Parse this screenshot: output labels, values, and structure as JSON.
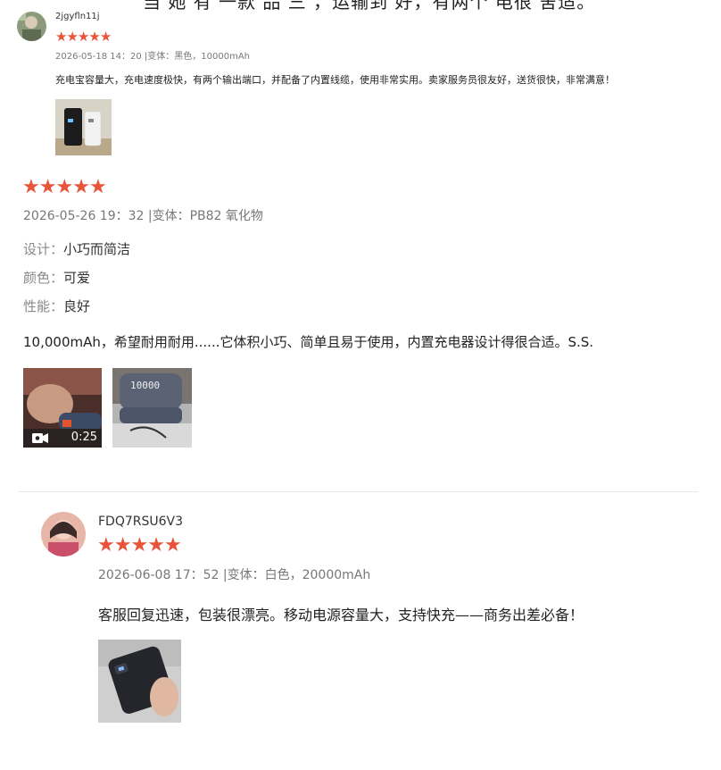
{
  "cutoff_text": "当 她 有  一款  品 三 ，运输到 好，有两个 电很 舍适。",
  "colors": {
    "star": "#e8543a",
    "text": "#222222",
    "meta": "#777777",
    "divider": "#e9e9e9"
  },
  "reviews": [
    {
      "username": "2jgyfln11j",
      "rating": 5,
      "meta": "2026-05-18 14：20 |变体：黑色，10000mAh",
      "body": "充电宝容量大，充电速度极快，有两个输出端口，并配备了内置线缆，使用非常实用。卖家服务员很友好，送货很快，非常满意！",
      "images": [
        {
          "kind": "photo",
          "icon": "powerbank-photo"
        }
      ]
    },
    {
      "username": "",
      "rating": 5,
      "meta": "2026-05-26 19：32 |变体：PB82 氧化物",
      "attributes": [
        {
          "key": "设计：",
          "value": "小巧而简洁"
        },
        {
          "key": "颜色：",
          "value": "可爱"
        },
        {
          "key": "性能：",
          "value": "良好"
        }
      ],
      "body": "10,000mAh，希望耐用耐用......它体积小巧、简单且易于使用，内置充电器设计得很合适。S.S.",
      "images": [
        {
          "kind": "video",
          "duration": "0:25",
          "icon": "video-camera-icon"
        },
        {
          "kind": "photo",
          "overlay_text": "10000",
          "icon": "powerbank-photo"
        }
      ]
    },
    {
      "username": "FDQ7RSU6V3",
      "rating": 5,
      "meta": "2026-06-08 17：52 |变体：白色，20000mAh",
      "body": "客服回复迅速，包装很漂亮。移动电源容量大，支持快充——商务出差必备！",
      "images": [
        {
          "kind": "photo",
          "icon": "powerbank-photo"
        }
      ]
    }
  ]
}
